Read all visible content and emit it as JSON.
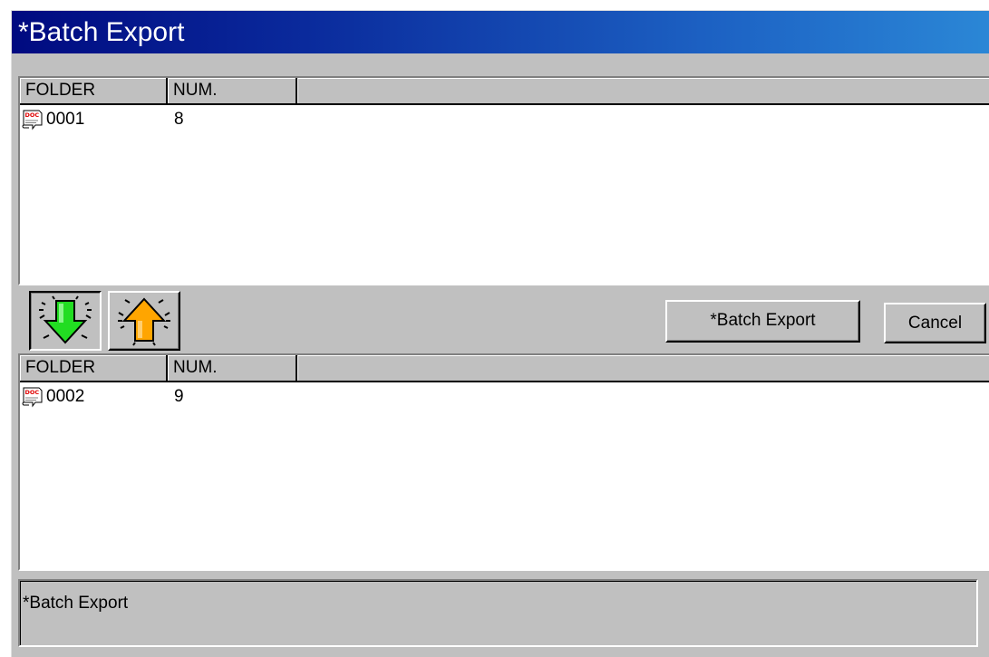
{
  "window": {
    "title": "*Batch Export"
  },
  "top_list": {
    "columns": [
      "FOLDER",
      "NUM."
    ],
    "rows": [
      {
        "folder": "0001",
        "num": "8"
      }
    ]
  },
  "toolbar": {
    "move_down_icon": "green-down-arrow-icon",
    "move_up_icon": "orange-up-arrow-icon",
    "export_label": "*Batch Export",
    "cancel_label": "Cancel"
  },
  "bottom_list": {
    "columns": [
      "FOLDER",
      "NUM."
    ],
    "rows": [
      {
        "folder": "0002",
        "num": "9"
      }
    ]
  },
  "status": {
    "text": "*Batch Export"
  },
  "colors": {
    "title_start": "#000a80",
    "title_end": "#2b87d6",
    "face": "#c0c0c0",
    "down_arrow": "#22dd22",
    "up_arrow": "#ffa500"
  }
}
